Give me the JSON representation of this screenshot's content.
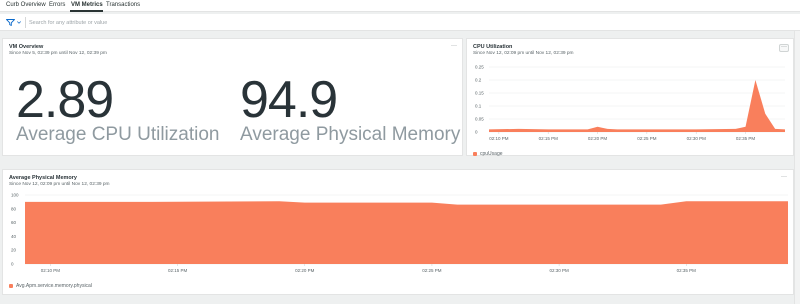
{
  "tabs": [
    {
      "label": "Curb Overview"
    },
    {
      "label": "Errors"
    },
    {
      "label": "VM Metrics",
      "active": true
    },
    {
      "label": "Transactions"
    }
  ],
  "filter": {
    "placeholder": "Search for any attribute or value",
    "icon": "filter-icon"
  },
  "colors": {
    "series": "#f97f5c",
    "text": "#293338",
    "muted": "#8f9aa0",
    "grid": "#e8eaeb"
  },
  "vm_overview": {
    "title": "VM Overview",
    "subtitle": "Since Nov 5, 02:39 pm until Nov 12, 02:39 pm",
    "billboards": [
      {
        "value": "2.89",
        "label": "Average CPU Utilization"
      },
      {
        "value": "94.9",
        "label": "Average Physical Memory"
      }
    ]
  },
  "cpu_card": {
    "title": "CPU Utilization",
    "subtitle": "Since Nov 12, 02:09 pm until Nov 12, 02:39 pm",
    "legend": "cpuUsage"
  },
  "memory_card": {
    "title": "Average Physical Memory",
    "subtitle": "Since Nov 12, 02:09 pm until Nov 12, 02:39 pm",
    "legend": "Avg.Apm.service.memory.physical"
  },
  "chart_data": [
    {
      "type": "area",
      "title": "CPU Utilization",
      "series": [
        {
          "name": "cpuUsage",
          "x": [
            "02:09 PM",
            "02:12 PM",
            "02:15 PM",
            "02:18 PM",
            "02:19 PM",
            "02:20 PM",
            "02:21 PM",
            "02:22 PM",
            "02:25 PM",
            "02:30 PM",
            "02:34 PM",
            "02:35 PM",
            "02:36 PM",
            "02:37 PM",
            "02:38 PM",
            "02:39 PM"
          ],
          "values": [
            0.01,
            0.012,
            0.01,
            0.01,
            0.01,
            0.02,
            0.012,
            0.01,
            0.01,
            0.01,
            0.012,
            0.02,
            0.2,
            0.07,
            0.012,
            0.01
          ]
        }
      ],
      "x_ticks": [
        "02:10 PM",
        "02:15 PM",
        "02:20 PM",
        "02:25 PM",
        "02:30 PM",
        "02:35 PM"
      ],
      "y_ticks": [
        "0",
        "0.05",
        "0.1",
        "0.15",
        "0.2",
        "0.25"
      ],
      "ylim": [
        0,
        0.25
      ],
      "grid": true,
      "legend_position": "bottom-left"
    },
    {
      "type": "area",
      "title": "Average Physical Memory",
      "series": [
        {
          "name": "Avg.Apm.service.memory.physical",
          "x": [
            "02:09 PM",
            "02:14 PM",
            "02:19 PM",
            "02:20 PM",
            "02:25 PM",
            "02:26 PM",
            "02:30 PM",
            "02:34 PM",
            "02:35 PM",
            "02:39 PM"
          ],
          "values": [
            90,
            90,
            91,
            89,
            89,
            86,
            86,
            86,
            91,
            91
          ]
        }
      ],
      "x_ticks": [
        "02:10 PM",
        "02:15 PM",
        "02:20 PM",
        "02:25 PM",
        "02:30 PM",
        "02:35 PM"
      ],
      "y_ticks": [
        "0",
        "20",
        "40",
        "60",
        "80",
        "100"
      ],
      "ylim": [
        0,
        100
      ],
      "grid": true,
      "legend_position": "bottom-left"
    }
  ]
}
